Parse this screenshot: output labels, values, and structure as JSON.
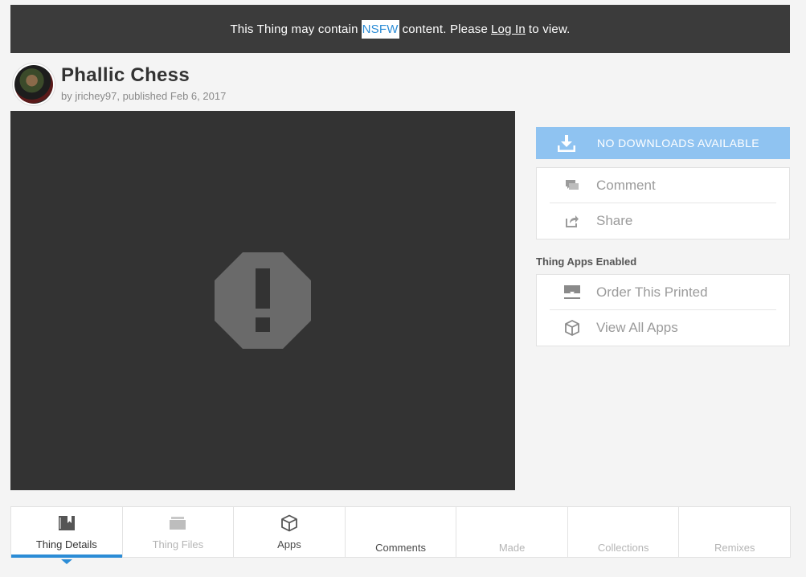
{
  "banner": {
    "text_before": "This Thing may contain",
    "nsfw_tag": "NSFW",
    "text_middle": "content. Please",
    "login_link": "Log In",
    "text_after": "to view."
  },
  "thing": {
    "title": "Phallic Chess",
    "by_prefix": "by",
    "author": "jrichey97",
    "published_prefix": ", published",
    "published_date": "Feb 6, 2017"
  },
  "sidebar": {
    "download_label": "NO DOWNLOADS AVAILABLE",
    "comment_label": "Comment",
    "share_label": "Share",
    "apps_heading": "Thing Apps Enabled",
    "order_printed_label": "Order This Printed",
    "view_all_apps_label": "View All Apps"
  },
  "tabs": [
    {
      "label": "Thing Details",
      "icon": "book-icon"
    },
    {
      "label": "Thing Files",
      "icon": "folder-icon"
    },
    {
      "label": "Apps",
      "icon": "cube-icon"
    },
    {
      "label": "Comments"
    },
    {
      "label": "Made"
    },
    {
      "label": "Collections"
    },
    {
      "label": "Remixes"
    }
  ],
  "colors": {
    "accent": "#2b8cd6",
    "download_button": "#8fc3f1",
    "banner_bg": "#3b3b3b",
    "preview_bg": "#333333"
  }
}
